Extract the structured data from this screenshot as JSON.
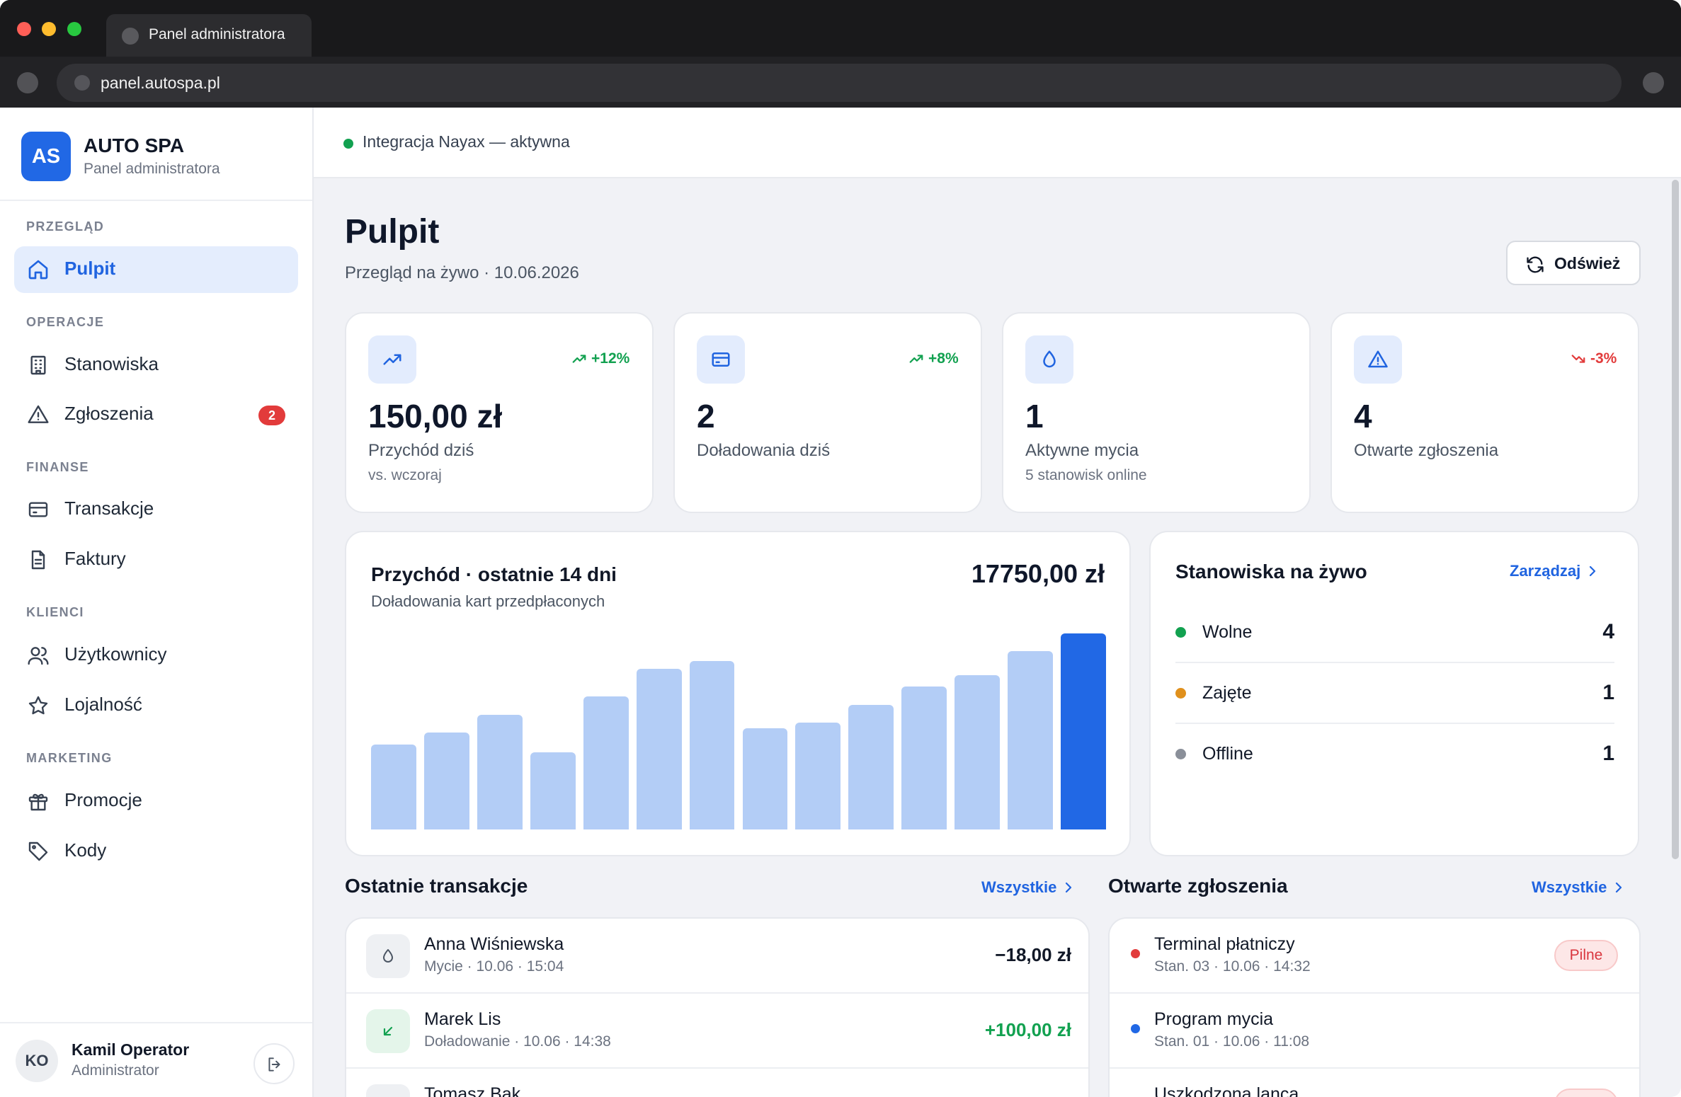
{
  "browser": {
    "tab_title": "Panel administratora",
    "url": "panel.autospa.pl"
  },
  "brand": {
    "logo": "AS",
    "name": "AUTO SPA",
    "subtitle": "Panel administratora"
  },
  "sidebar": {
    "sections": [
      {
        "title": "PRZEGLĄD"
      },
      {
        "title": "OPERACJE"
      },
      {
        "title": "FINANSE"
      },
      {
        "title": "KLIENCI"
      },
      {
        "title": "MARKETING"
      }
    ],
    "items": [
      {
        "label": "Pulpit",
        "icon": "home-icon",
        "active": true
      },
      {
        "label": "Stanowiska",
        "icon": "building-icon"
      },
      {
        "label": "Zgłoszenia",
        "icon": "alert-triangle-icon",
        "badge": "2"
      },
      {
        "label": "Transakcje",
        "icon": "credit-card-icon"
      },
      {
        "label": "Faktury",
        "icon": "document-icon"
      },
      {
        "label": "Użytkownicy",
        "icon": "users-icon"
      },
      {
        "label": "Lojalność",
        "icon": "star-icon"
      },
      {
        "label": "Promocje",
        "icon": "gift-icon"
      },
      {
        "label": "Kody",
        "icon": "tag-icon"
      }
    ]
  },
  "user": {
    "initials": "KO",
    "name": "Kamil Operator",
    "role": "Administrator"
  },
  "topbar": {
    "status": "Integracja Nayax — aktywna",
    "status_color": "#12a150"
  },
  "page": {
    "title": "Pulpit",
    "subtitle": "Przegląd na żywo · 10.06.2026",
    "refresh_label": "Odśwież"
  },
  "kpis": [
    {
      "value": "150,00 zł",
      "label": "Przychód dziś",
      "sub": "vs. wczoraj",
      "trend": "+12%",
      "trend_dir": "up",
      "icon": "trending-up-icon"
    },
    {
      "value": "2",
      "label": "Doładowania dziś",
      "sub": "",
      "trend": "+8%",
      "trend_dir": "up",
      "icon": "credit-card-icon"
    },
    {
      "value": "1",
      "label": "Aktywne mycia",
      "sub": "5 stanowisk online",
      "trend": "",
      "icon": "droplet-icon"
    },
    {
      "value": "4",
      "label": "Otwarte zgłoszenia",
      "sub": "",
      "trend": "-3%",
      "trend_dir": "down",
      "icon": "alert-triangle-icon"
    }
  ],
  "revenue_chart": {
    "title": "Przychód · ostatnie 14 dni",
    "subtitle": "Doładowania kart przedpłaconych",
    "total": "17750,00 zł"
  },
  "chart_data": {
    "type": "bar",
    "title": "Przychód · ostatnie 14 dni",
    "values": [
      43,
      49,
      58,
      39,
      67,
      81,
      85,
      51,
      54,
      63,
      72,
      78,
      90,
      99
    ],
    "highlight_index": 13,
    "colors": {
      "bar": "#b3cdf6",
      "highlight": "#2168e5"
    }
  },
  "live": {
    "title": "Stanowiska na żywo",
    "manage_label": "Zarządzaj",
    "rows": [
      {
        "label": "Wolne",
        "count": "4",
        "color": "#12a150"
      },
      {
        "label": "Zajęte",
        "count": "1",
        "color": "#e0901c"
      },
      {
        "label": "Offline",
        "count": "1",
        "color": "#8a8f99"
      }
    ]
  },
  "transactions": {
    "title": "Ostatnie transakcje",
    "all_label": "Wszystkie",
    "rows": [
      {
        "name": "Anna Wiśniewska",
        "meta": "Mycie · 10.06 · 15:04",
        "amount": "−18,00 zł",
        "type": "wash",
        "icon": "droplet-icon"
      },
      {
        "name": "Marek Lis",
        "meta": "Doładowanie · 10.06 · 14:38",
        "amount": "+100,00 zł",
        "type": "topup",
        "icon": "arrow-down-left-icon"
      },
      {
        "name": "Tomasz Bąk",
        "meta": "",
        "amount": "",
        "type": "wash",
        "icon": "droplet-icon"
      }
    ]
  },
  "issues": {
    "title": "Otwarte zgłoszenia",
    "all_label": "Wszystkie",
    "rows": [
      {
        "name": "Terminal płatniczy",
        "meta": "Stan. 03 · 10.06 · 14:32",
        "badge": "Pilne",
        "color": "#e23b3b"
      },
      {
        "name": "Program mycia",
        "meta": "Stan. 01 · 10.06 · 11:08",
        "badge": "",
        "color": "#2168e5"
      },
      {
        "name": "Uszkodzona lanca",
        "meta": "",
        "badge": "",
        "color": "#e23b3b"
      }
    ]
  }
}
